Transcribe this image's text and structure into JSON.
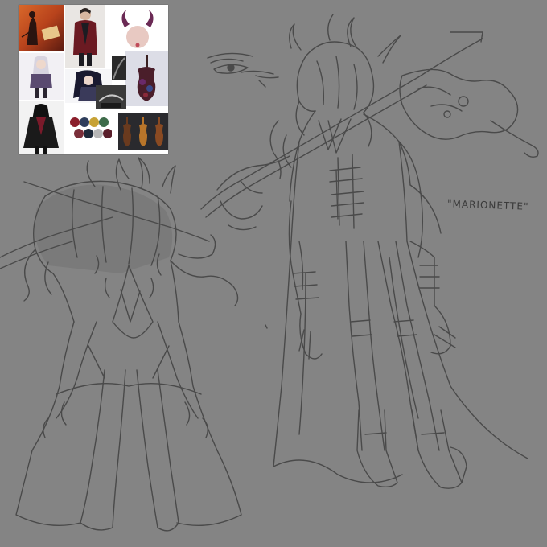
{
  "sketch": {
    "title_label": "\"MARIONETTE\""
  },
  "colors": {
    "canvas_background": "#848484",
    "line_color": "#4a4a4a",
    "shade_color": "#777777",
    "reference_board_background": "#ffffff"
  },
  "palette": {
    "swatches": [
      "#8b1e2b",
      "#2f3e5c",
      "#c7a235",
      "#3e6b4a",
      "#7a2f3a",
      "#1f2a3a",
      "#b7b7b7",
      "#5a1f2b"
    ]
  }
}
